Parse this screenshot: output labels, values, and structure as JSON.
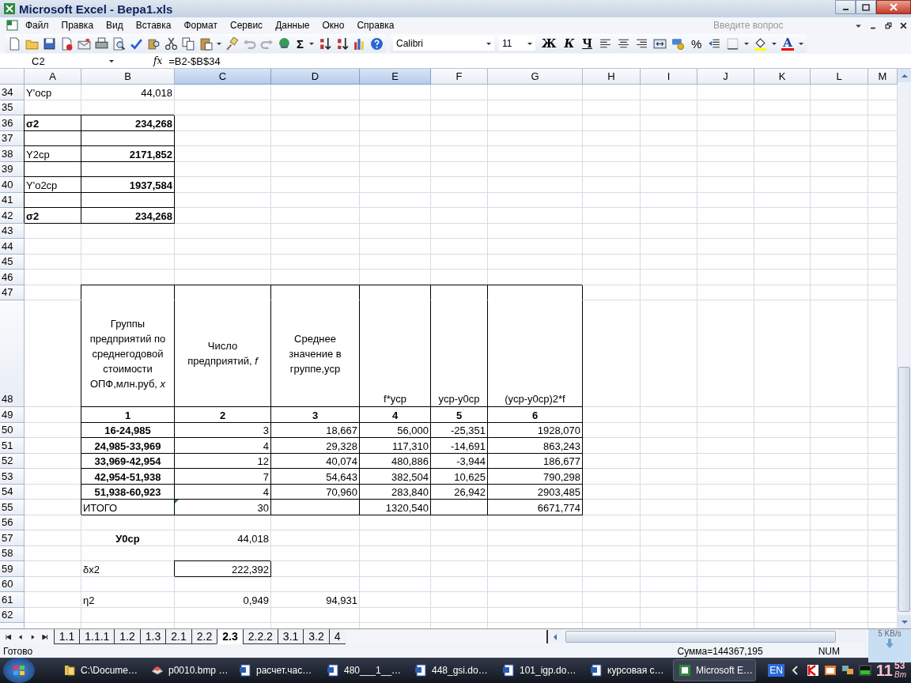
{
  "window": {
    "title": "Microsoft Excel - Вера1.xls"
  },
  "menu": [
    "Файл",
    "Правка",
    "Вид",
    "Вставка",
    "Формат",
    "Сервис",
    "Данные",
    "Окно",
    "Справка"
  ],
  "help_box": {
    "placeholder": "Введите вопрос"
  },
  "toolbar": {
    "sum": "Σ",
    "font": "Calibri",
    "size": "11",
    "styles": [
      "Ж",
      "К",
      "Ч"
    ],
    "percent": "%",
    "font_color": "A"
  },
  "formula_bar": {
    "name_box": "C2",
    "fx": "fx",
    "formula": "=B2-$B$34"
  },
  "columns": [
    {
      "label": "A",
      "selected": false
    },
    {
      "label": "B",
      "selected": false
    },
    {
      "label": "C",
      "selected": true
    },
    {
      "label": "D",
      "selected": true
    },
    {
      "label": "E",
      "selected": true
    },
    {
      "label": "F",
      "selected": false
    },
    {
      "label": "G",
      "selected": false
    },
    {
      "label": "H",
      "selected": false
    },
    {
      "label": "I",
      "selected": false
    },
    {
      "label": "J",
      "selected": false
    },
    {
      "label": "K",
      "selected": false
    },
    {
      "label": "L",
      "selected": false
    },
    {
      "label": "M",
      "selected": false
    }
  ],
  "rows": [
    {
      "number": "34",
      "kind": "normal",
      "cells": [
        {
          "kind": "label",
          "text": "Y'оср",
          "boxed": false
        },
        {
          "kind": "number",
          "text": "44,018",
          "boxed": false
        }
      ]
    },
    {
      "number": "35",
      "kind": "normal"
    },
    {
      "number": "36",
      "kind": "normal",
      "cells": [
        {
          "kind": "bold-label",
          "text": "σ2",
          "boxed": true
        },
        {
          "kind": "bold-number",
          "text": "234,268",
          "boxed": true
        }
      ]
    },
    {
      "number": "37",
      "kind": "normal",
      "cells": [
        {
          "boxed": true
        },
        {
          "boxed": true
        }
      ]
    },
    {
      "number": "38",
      "kind": "normal",
      "cells": [
        {
          "kind": "label",
          "text": "Y2ср",
          "boxed": true
        },
        {
          "kind": "bold-number",
          "text": "2171,852",
          "boxed": true
        }
      ]
    },
    {
      "number": "39",
      "kind": "normal",
      "cells": [
        {
          "boxed": true
        },
        {
          "boxed": true
        }
      ]
    },
    {
      "number": "40",
      "kind": "normal",
      "cells": [
        {
          "kind": "label",
          "text": "Y'о2ср",
          "boxed": true
        },
        {
          "kind": "bold-number",
          "text": "1937,584",
          "boxed": true
        }
      ]
    },
    {
      "number": "41",
      "kind": "normal",
      "cells": [
        {
          "boxed": true
        },
        {
          "boxed": true
        }
      ]
    },
    {
      "number": "42",
      "kind": "normal",
      "cells": [
        {
          "kind": "bold-label",
          "text": "σ2",
          "boxed": true
        },
        {
          "kind": "bold-number",
          "text": "234,268",
          "boxed": true
        }
      ]
    },
    {
      "number": "43",
      "kind": "normal"
    },
    {
      "number": "44",
      "kind": "normal"
    },
    {
      "number": "45",
      "kind": "normal"
    },
    {
      "number": "46",
      "kind": "normal"
    },
    {
      "number": "47",
      "kind": "normal",
      "cells": [
        null,
        {
          "kind": "merge-start",
          "boxed": true
        },
        {
          "kind": "merge-start",
          "boxed": true
        },
        {
          "kind": "merge-start",
          "boxed": true
        },
        {
          "kind": "merge-start",
          "boxed": true
        },
        {
          "kind": "merge-start",
          "boxed": true
        },
        {
          "kind": "merge-start",
          "boxed": true
        }
      ]
    },
    {
      "number": "48",
      "kind": "tall",
      "cells": [
        null,
        {
          "kind": "heading",
          "text": "Группы предприятий по среднегодовой стоимости ОПФ,млн.руб, *x*",
          "boxed": true
        },
        {
          "kind": "heading",
          "text": "Число предприятий, *f*",
          "boxed": true
        },
        {
          "kind": "heading",
          "text": "Среднее значение в группе,уср",
          "boxed": true
        },
        {
          "kind": "caption",
          "text": "f*уср",
          "boxed": true
        },
        {
          "kind": "caption",
          "text": "уср-у0ср",
          "boxed": true
        },
        {
          "kind": "caption",
          "text": "(уср-у0ср)2*f",
          "boxed": true
        }
      ]
    },
    {
      "number": "49",
      "kind": "normal",
      "cells": [
        null,
        {
          "kind": "group",
          "text": "1",
          "boxed": true
        },
        {
          "kind": "group",
          "text": "2",
          "boxed": true
        },
        {
          "kind": "group",
          "text": "3",
          "boxed": true
        },
        {
          "kind": "group",
          "text": "4",
          "boxed": true
        },
        {
          "kind": "group",
          "text": "5",
          "boxed": true
        },
        {
          "kind": "group",
          "text": "6",
          "boxed": true
        }
      ]
    },
    {
      "number": "50",
      "kind": "normal",
      "cells": [
        null,
        {
          "kind": "group",
          "text": "16-24,985",
          "boxed": true
        },
        {
          "kind": "number",
          "text": "3",
          "boxed": true
        },
        {
          "kind": "number",
          "text": "18,667",
          "boxed": true
        },
        {
          "kind": "number",
          "text": "56,000",
          "boxed": true
        },
        {
          "kind": "number",
          "text": "-25,351",
          "boxed": true
        },
        {
          "kind": "number",
          "text": "1928,070",
          "boxed": true
        }
      ]
    },
    {
      "number": "51",
      "kind": "normal",
      "cells": [
        null,
        {
          "kind": "group",
          "text": "24,985-33,969",
          "boxed": true
        },
        {
          "kind": "number",
          "text": "4",
          "boxed": true
        },
        {
          "kind": "number",
          "text": "29,328",
          "boxed": true
        },
        {
          "kind": "number",
          "text": "117,310",
          "boxed": true
        },
        {
          "kind": "number",
          "text": "-14,691",
          "boxed": true
        },
        {
          "kind": "number",
          "text": "863,243",
          "boxed": true
        }
      ]
    },
    {
      "number": "52",
      "kind": "normal",
      "cells": [
        null,
        {
          "kind": "group",
          "text": "33,969-42,954",
          "boxed": true
        },
        {
          "kind": "number",
          "text": "12",
          "boxed": true
        },
        {
          "kind": "number",
          "text": "40,074",
          "boxed": true
        },
        {
          "kind": "number",
          "text": "480,886",
          "boxed": true
        },
        {
          "kind": "number",
          "text": "-3,944",
          "boxed": true
        },
        {
          "kind": "number",
          "text": "186,677",
          "boxed": true
        }
      ]
    },
    {
      "number": "53",
      "kind": "normal",
      "cells": [
        null,
        {
          "kind": "group",
          "text": "42,954-51,938",
          "boxed": true
        },
        {
          "kind": "number",
          "text": "7",
          "boxed": true
        },
        {
          "kind": "number",
          "text": "54,643",
          "boxed": true
        },
        {
          "kind": "number",
          "text": "382,504",
          "boxed": true
        },
        {
          "kind": "number",
          "text": "10,625",
          "boxed": true
        },
        {
          "kind": "number",
          "text": "790,298",
          "boxed": true
        }
      ]
    },
    {
      "number": "54",
      "kind": "normal",
      "cells": [
        null,
        {
          "kind": "group",
          "text": "51,938-60,923",
          "boxed": true
        },
        {
          "kind": "number",
          "text": "4",
          "boxed": true
        },
        {
          "kind": "number",
          "text": "70,960",
          "boxed": true
        },
        {
          "kind": "number",
          "text": "283,840",
          "boxed": true
        },
        {
          "kind": "number",
          "text": "26,942",
          "boxed": true
        },
        {
          "kind": "number",
          "text": "2903,485",
          "boxed": true
        }
      ]
    },
    {
      "number": "55",
      "kind": "normal",
      "cells": [
        null,
        {
          "kind": "label",
          "text": "ИТОГО",
          "boxed": true
        },
        {
          "kind": "number",
          "text": "30",
          "boxed": true,
          "error_mark": true
        },
        {
          "boxed": true
        },
        {
          "kind": "number",
          "text": "1320,540",
          "boxed": true
        },
        {
          "boxed": true
        },
        {
          "kind": "number",
          "text": "6671,774",
          "boxed": true
        }
      ]
    },
    {
      "number": "56",
      "kind": "normal"
    },
    {
      "number": "57",
      "kind": "normal",
      "cells": [
        null,
        {
          "kind": "group",
          "text": "У0ср",
          "boxed": false
        },
        {
          "kind": "number",
          "text": "44,018",
          "boxed": false
        }
      ]
    },
    {
      "number": "58",
      "kind": "normal"
    },
    {
      "number": "59",
      "kind": "normal",
      "cells": [
        null,
        {
          "kind": "label",
          "text": "δх2",
          "boxed": false
        },
        {
          "kind": "number",
          "text": "222,392",
          "boxed": true
        }
      ]
    },
    {
      "number": "60",
      "kind": "normal"
    },
    {
      "number": "61",
      "kind": "normal",
      "cells": [
        null,
        {
          "kind": "label",
          "text": "η2",
          "boxed": false
        },
        {
          "kind": "number",
          "text": "0,949",
          "boxed": false
        },
        {
          "kind": "number",
          "text": "94,931",
          "boxed": false
        }
      ]
    },
    {
      "number": "62",
      "kind": "normal"
    }
  ],
  "sheet_tabs": [
    {
      "label": "1.1",
      "selected": false
    },
    {
      "label": "1.1.1",
      "selected": false
    },
    {
      "label": "1.2",
      "selected": false
    },
    {
      "label": "1.3",
      "selected": false
    },
    {
      "label": "2.1",
      "selected": false
    },
    {
      "label": "2.2",
      "selected": false
    },
    {
      "label": "2.3",
      "selected": true
    },
    {
      "label": "2.2.2",
      "selected": false
    },
    {
      "label": "3.1",
      "selected": false
    },
    {
      "label": "3.2",
      "selected": false
    },
    {
      "label": "4",
      "selected": false
    }
  ],
  "status_bar": {
    "state": "Готово",
    "sum": "Сумма=144367,195",
    "num": "NUM"
  },
  "network_gadget": {
    "speed": "5 KB/s"
  },
  "taskbar": {
    "items": [
      {
        "kind": "folder",
        "label": "C:\\Docume…",
        "selected": false
      },
      {
        "kind": "viewer",
        "label": "p0010.bmp …",
        "selected": false
      },
      {
        "kind": "word",
        "label": "расчет.час…",
        "selected": false
      },
      {
        "kind": "word",
        "label": "480___1__…",
        "selected": false
      },
      {
        "kind": "word",
        "label": "448_gsi.do…",
        "selected": false
      },
      {
        "kind": "word",
        "label": "101_igp.do…",
        "selected": false
      },
      {
        "kind": "word",
        "label": "курсовая с…",
        "selected": false
      },
      {
        "kind": "excel",
        "label": "Microsoft E…",
        "selected": true
      }
    ],
    "language": "EN",
    "clock_hours": "11",
    "clock_minutes": "53",
    "clock_day": "Вт"
  }
}
